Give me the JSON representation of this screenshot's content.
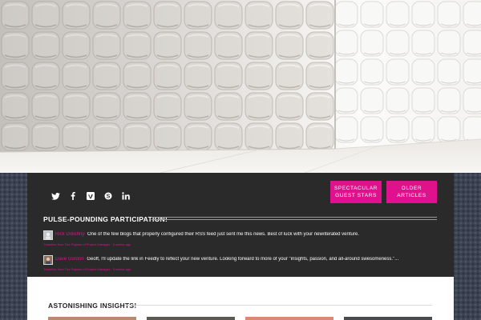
{
  "hero": {
    "image": "padded-room-photo"
  },
  "social": {
    "icons": [
      "twitter-icon",
      "facebook-icon",
      "vimeo-icon",
      "skype-icon",
      "linkedin-icon"
    ]
  },
  "nav": {
    "guest_stars": [
      "SPECTACULAR",
      "GUEST STARS"
    ],
    "older_articles": [
      "OLDER",
      "ARTICLES"
    ]
  },
  "participation": {
    "title": "PULSE-POUNDING PARTICIPATION!",
    "comments": [
      {
        "author": "Rick Dolishny",
        "text": "One of the few blogs that properly configured their RSS feed just sent me this news. Best of luck with your new/iterated venture.",
        "meta": "Tradeline from The Pajama of Project Manager · 5 weeks ago"
      },
      {
        "author": "Dave Gordon",
        "text": "Geoff, I'll update the link in Feedly to reflect your new venture. Looking forward to more of your \"insights, passion, and all-around swesomeness.\"...",
        "meta": "Tradeline from The Pajama of Project Manager · 5 weeks ago"
      }
    ]
  },
  "insights": {
    "title": "ASTONISHING INSIGHTS!"
  },
  "colors": {
    "accent": "#e0118c",
    "panel": "#2a2a2a",
    "page_bg": "#3a4150"
  }
}
